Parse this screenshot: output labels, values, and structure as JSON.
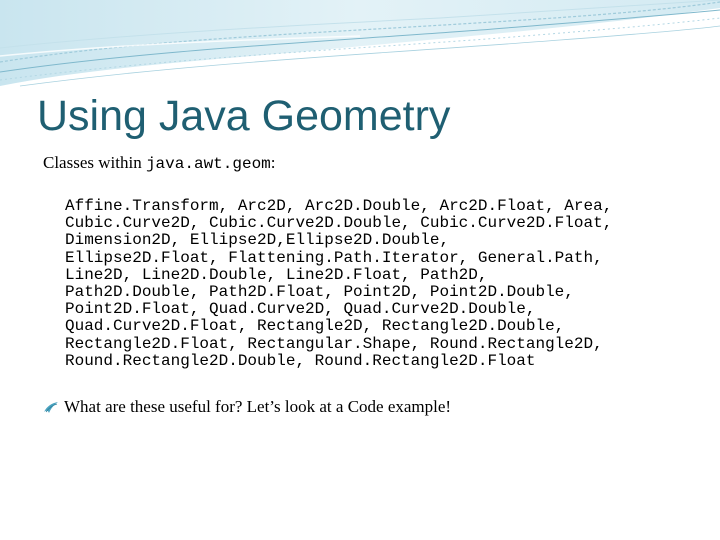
{
  "slide": {
    "title": "Using Java Geometry",
    "intro": {
      "prefix": "Classes within ",
      "package": "java.awt.geom",
      "suffix": ":"
    },
    "class_lines": [
      "Affine.Transform, Arc2D, Arc2D.Double, Arc2D.Float, Area,",
      "Cubic.Curve2D, Cubic.Curve2D.Double, Cubic.Curve2D.Float,",
      "Dimension2D, Ellipse2D,Ellipse2D.Double,",
      "Ellipse2D.Float, Flattening.Path.Iterator, General.Path,",
      "Line2D, Line2D.Double, Line2D.Float, Path2D,",
      "Path2D.Double, Path2D.Float, Point2D, Point2D.Double,",
      "Point2D.Float, Quad.Curve2D, Quad.Curve2D.Double,",
      "Quad.Curve2D.Float, Rectangle2D, Rectangle2D.Double,",
      "Rectangle2D.Float, Rectangular.Shape, Round.Rectangle2D,",
      "Round.Rectangle2D.Double, Round.Rectangle2D.Float"
    ],
    "bullet_text": "What are these useful for? Let’s look at a Code example!"
  },
  "colors": {
    "title": "#1f5f72",
    "deco_band": "#d7ecf3",
    "deco_lines": "#7fb8cc",
    "bullet_icon": "#4aa3c0"
  }
}
